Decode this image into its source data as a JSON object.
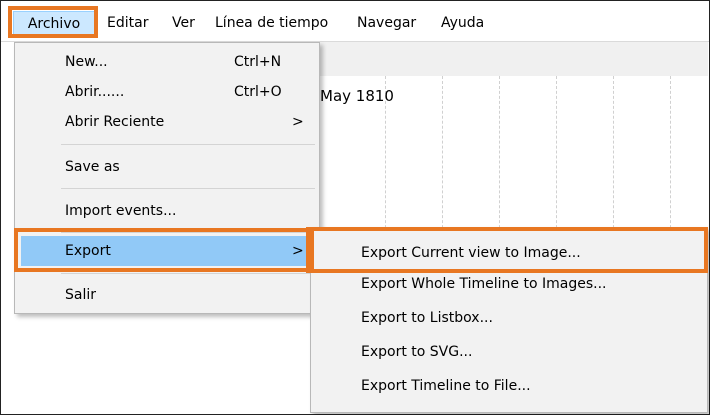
{
  "menubar": {
    "items": [
      {
        "label": "Archivo"
      },
      {
        "label": "Editar"
      },
      {
        "label": "Ver"
      },
      {
        "label": "Línea de tiempo"
      },
      {
        "label": "Navegar"
      },
      {
        "label": "Ayuda"
      }
    ]
  },
  "timeline": {
    "date_label": "May 1810"
  },
  "archivo_menu": {
    "items": [
      {
        "label": "New...",
        "shortcut": "Ctrl+N"
      },
      {
        "label": "Abrir......",
        "shortcut": "Ctrl+O"
      },
      {
        "label": "Abrir Reciente",
        "arrow": ">"
      },
      {
        "label": "Save as"
      },
      {
        "label": "Import events..."
      },
      {
        "label": "Export",
        "arrow": ">"
      },
      {
        "label": "Salir"
      }
    ]
  },
  "export_submenu": {
    "items": [
      {
        "label": "Export Current view to Image..."
      },
      {
        "label": "Export Whole Timeline to Images..."
      },
      {
        "label": "Export to Listbox..."
      },
      {
        "label": "Export to SVG..."
      },
      {
        "label": "Export Timeline to File..."
      }
    ]
  },
  "colors": {
    "highlight_outline": "#e87722",
    "selected_item": "#91c9f7",
    "menubar_active": "#cce8ff"
  }
}
